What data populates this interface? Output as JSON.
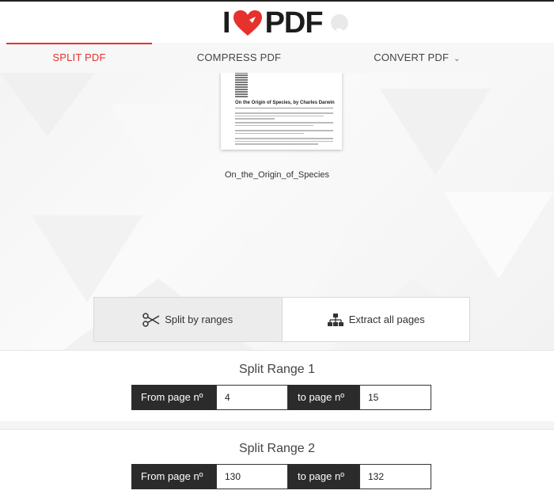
{
  "brand": {
    "left": "I",
    "right": "PDF",
    "accent": "#e5322d"
  },
  "nav": {
    "items": [
      {
        "label": "SPLIT PDF",
        "active": true
      },
      {
        "label": "COMPRESS PDF",
        "active": false
      },
      {
        "label": "CONVERT PDF",
        "active": false,
        "dropdown": true
      }
    ]
  },
  "preview": {
    "doc_title": "On the Origin of Species, by Charles Darwin",
    "filename": "On_the_Origin_of_Species"
  },
  "modes": [
    {
      "label": "Split by ranges",
      "icon": "scissors-icon",
      "active": true
    },
    {
      "label": "Extract all pages",
      "icon": "hierarchy-icon",
      "active": false
    }
  ],
  "ranges": [
    {
      "title": "Split Range 1",
      "from_label": "From page nº",
      "from": "4",
      "to_label": "to page nº",
      "to": "15"
    },
    {
      "title": "Split Range 2",
      "from_label": "From page nº",
      "from": "130",
      "to_label": "to page nº",
      "to": "132"
    }
  ]
}
